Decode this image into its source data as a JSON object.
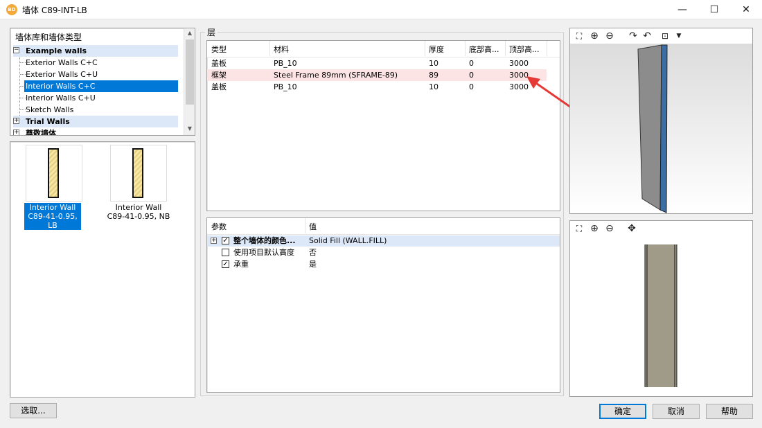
{
  "window": {
    "title": "墙体 C89-INT-LB",
    "icon_label": "BD",
    "controls": {
      "minimize": "—",
      "maximize": "☐",
      "close": "✕"
    }
  },
  "tree": {
    "header": "墙体库和墙体类型",
    "items": [
      {
        "label": "Example walls",
        "bold": true,
        "expander": "−"
      },
      {
        "label": "Exterior Walls C+C"
      },
      {
        "label": "Exterior Walls C+U"
      },
      {
        "label": "Interior Walls C+C",
        "selected": true
      },
      {
        "label": "Interior Walls C+U"
      },
      {
        "label": "Sketch Walls"
      },
      {
        "label": "Trial Walls",
        "bold": true,
        "expander": "+"
      },
      {
        "label": "尊敬墙体",
        "bold": true,
        "expander": "+"
      }
    ]
  },
  "thumbnails": [
    {
      "line1": "Interior Wall",
      "line2": "C89-41-0.95, LB",
      "selected": true
    },
    {
      "line1": "Interior Wall",
      "line2": "C89-41-0.95, NB",
      "selected": false
    }
  ],
  "layers": {
    "group_label": "层",
    "columns": [
      "类型",
      "材料",
      "厚度",
      "底部高...",
      "顶部高..."
    ],
    "rows": [
      {
        "type": "盖板",
        "material": "PB_10",
        "thickness": "10",
        "bottom": "0",
        "top": "3000",
        "highlight": false
      },
      {
        "type": "框架",
        "material": "Steel Frame 89mm (SFRAME-89)",
        "thickness": "89",
        "bottom": "0",
        "top": "3000",
        "highlight": true
      },
      {
        "type": "盖板",
        "material": "PB_10",
        "thickness": "10",
        "bottom": "0",
        "top": "3000",
        "highlight": false
      }
    ]
  },
  "params": {
    "columns": [
      "参数",
      "值"
    ],
    "rows": [
      {
        "expander": "+",
        "checked": true,
        "label": "整个墙体的颜色...",
        "value": "Solid Fill  (WALL.FILL)",
        "bold": true
      },
      {
        "expander": "",
        "checked": false,
        "label": "使用项目默认高度",
        "value": "否",
        "bold": false
      },
      {
        "expander": "",
        "checked": true,
        "label": "承重",
        "value": "是",
        "bold": false
      }
    ]
  },
  "buttons": {
    "select": "选取...",
    "ok": "确定",
    "cancel": "取消",
    "help": "帮助"
  },
  "colors": {
    "selection": "#0078d7",
    "highlight_row": "#fde4e4",
    "annotation_arrow": "#e53935"
  }
}
